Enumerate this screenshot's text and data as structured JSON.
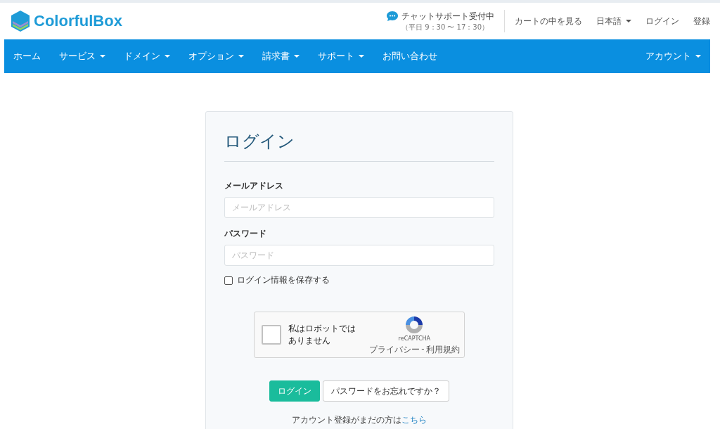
{
  "header": {
    "logo": "ColorfulBox",
    "chat": {
      "title": "チャットサポート受付中",
      "hours": "（平日 9：30 〜 17：30）"
    },
    "links": [
      {
        "label": "カートの中を見る",
        "dropdown": false
      },
      {
        "label": "日本語",
        "dropdown": true
      },
      {
        "label": "ログイン",
        "dropdown": false
      },
      {
        "label": "登録",
        "dropdown": false
      }
    ]
  },
  "nav": {
    "items": [
      {
        "label": "ホーム",
        "dropdown": false
      },
      {
        "label": "サービス",
        "dropdown": true
      },
      {
        "label": "ドメイン",
        "dropdown": true
      },
      {
        "label": "オプション",
        "dropdown": true
      },
      {
        "label": "請求書",
        "dropdown": true
      },
      {
        "label": "サポート",
        "dropdown": true
      },
      {
        "label": "お問い合わせ",
        "dropdown": false
      }
    ],
    "right": {
      "label": "アカウント",
      "dropdown": true
    }
  },
  "login": {
    "title": "ログイン",
    "fields": [
      {
        "label": "メールアドレス",
        "placeholder": "メールアドレス"
      },
      {
        "label": "パスワード",
        "placeholder": "パスワード"
      }
    ],
    "remember": {
      "label": "ログイン情報を保存する",
      "checked": false
    },
    "captcha": {
      "label": "私はロボットではありません",
      "checked": false,
      "brand": "reCAPTCHA",
      "privacy": "プライバシー",
      "separator": "-",
      "terms": "利用規約"
    },
    "submit": "ログイン",
    "forgot": "パスワードをお忘れですか？",
    "register": {
      "text": "アカウント登録がまだの方は",
      "link": "こちら"
    }
  }
}
